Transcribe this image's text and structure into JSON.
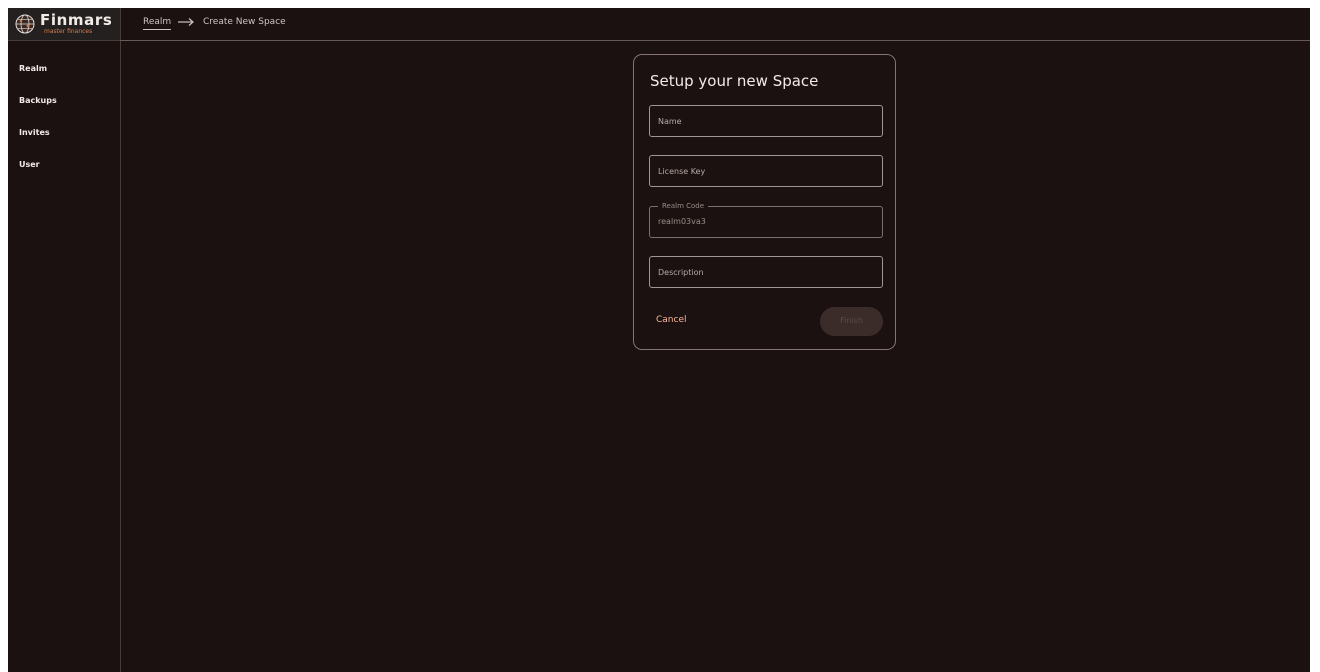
{
  "brand": {
    "name": "Finmars",
    "tagline": "master finances",
    "accent_color": "#d77b50"
  },
  "sidebar": {
    "items": [
      {
        "label": "Realm"
      },
      {
        "label": "Backups"
      },
      {
        "label": "Invites"
      },
      {
        "label": "User"
      }
    ]
  },
  "breadcrumb": {
    "parent": "Realm",
    "separator_icon": "arrow-right-icon",
    "current": "Create New Space"
  },
  "dialog": {
    "title": "Setup your new Space",
    "fields": {
      "name": {
        "placeholder": "Name"
      },
      "license_key": {
        "placeholder": "License Key"
      },
      "realm_code": {
        "label": "Realm Code",
        "value": "realm03va3"
      },
      "description": {
        "placeholder": "Description"
      }
    },
    "cancel_label": "Cancel",
    "finish_label": "Finish",
    "finish_disabled": true
  },
  "colors": {
    "background": "#1a1110",
    "text": "#f3ebe8",
    "border": "#a39590",
    "cancel": "#ffb59a",
    "finish_disabled_bg": "#3b2c29"
  }
}
